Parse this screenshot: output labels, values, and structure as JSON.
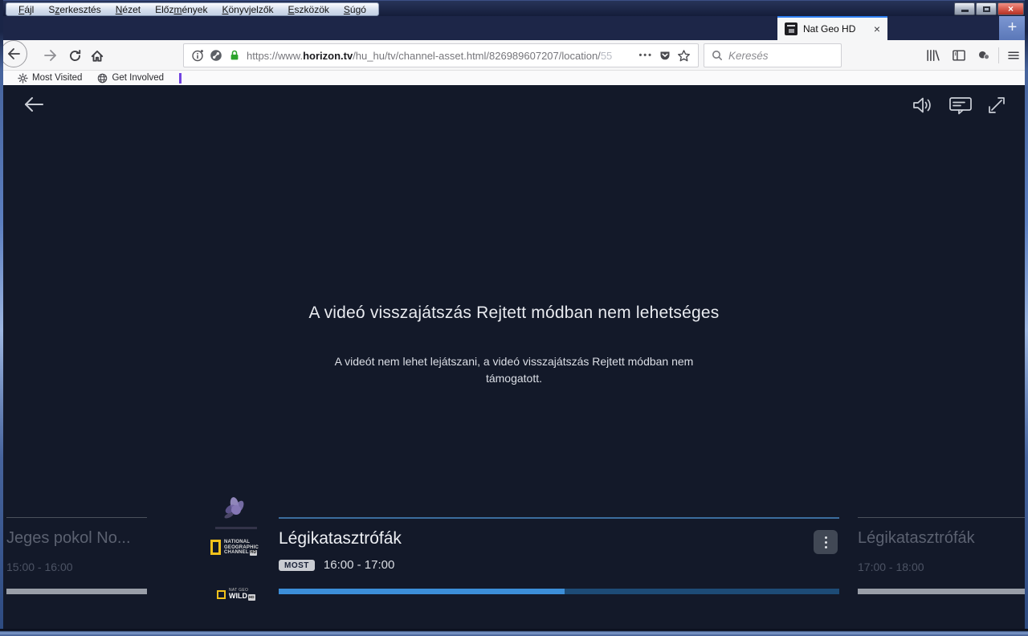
{
  "window": {
    "menu_items": [
      {
        "before": "",
        "key": "F",
        "after": "ájl"
      },
      {
        "before": "S",
        "key": "z",
        "after": "erkesztés"
      },
      {
        "before": "",
        "key": "N",
        "after": "ézet"
      },
      {
        "before": "Előz",
        "key": "m",
        "after": "ények"
      },
      {
        "before": "",
        "key": "K",
        "after": "önyvjelzők"
      },
      {
        "before": "",
        "key": "E",
        "after": "szközök"
      },
      {
        "before": "",
        "key": "S",
        "after": "úgó"
      }
    ],
    "close_glyph": "×"
  },
  "tab_bar": {
    "active_tab": {
      "title": "Nat Geo HD",
      "close_glyph": "×"
    },
    "new_tab_glyph": "+"
  },
  "toolbar": {
    "url": {
      "scheme": "https://www.",
      "domain": "horizon.tv",
      "path": "/hu_hu/tv/channel-asset.html/826989607207/location/",
      "truncated": "55"
    },
    "overflow_glyph": "•••",
    "search_placeholder": "Keresés"
  },
  "bookmarks_bar": {
    "items": [
      {
        "label": "Most Visited"
      },
      {
        "label": "Get Involved"
      }
    ]
  },
  "player_page": {
    "error_title": "A videó visszajátszás Rejtett módban nem lehetséges",
    "error_message": "A videót nem lehet lejátszani, a videó visszajátszás Rejtett módban nem támogatott."
  },
  "epg": {
    "previous": {
      "title": "Jeges pokol No...",
      "time": "15:00 - 16:00",
      "progress_percent": 100
    },
    "current": {
      "title": "Légikatasztrófák",
      "badge": "MOST",
      "time": "16:00 - 17:00",
      "progress_percent": 51
    },
    "next": {
      "title": "Légikatasztrófák",
      "time": "17:00 - 18:00",
      "progress_percent": 100
    }
  },
  "channels": {
    "natgeo": {
      "line1": "NATIONAL",
      "line2": "GEOGRAPHIC",
      "line3": "CHANNEL",
      "hd": "HD"
    },
    "wild": {
      "line1": "NAT GEO",
      "line2": "WILD",
      "hd": "HD"
    }
  },
  "colors": {
    "page_bg": "#131929",
    "tab_accent": "#2e7ef0",
    "progress_blue": "#3c8ed8",
    "progress_track": "#1d4b76",
    "progress_gray": "#999ea8",
    "badge_bg": "#c9ccd2",
    "bookmark_marker": "#7143e0",
    "natgeo_yellow": "#f2c21b",
    "lock_green": "#2ca32c"
  }
}
